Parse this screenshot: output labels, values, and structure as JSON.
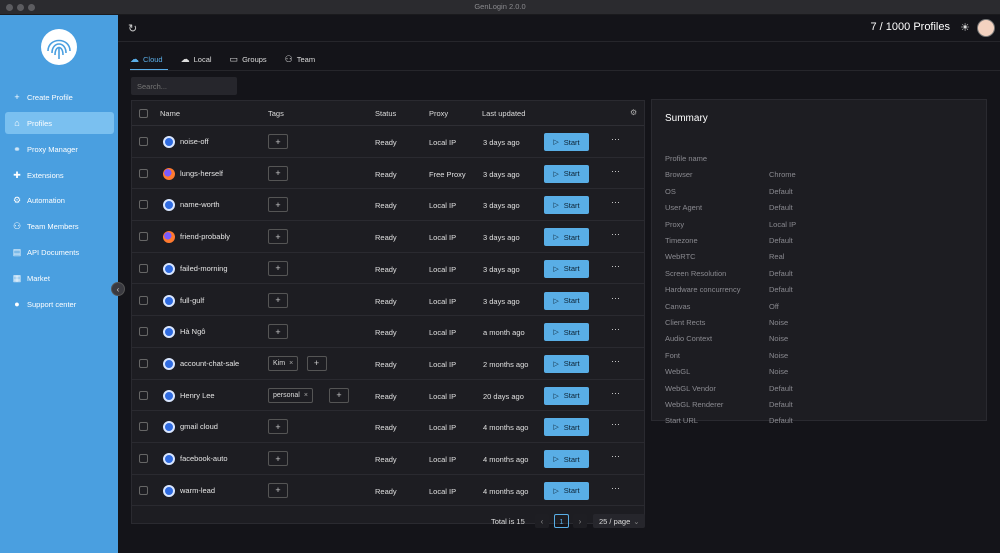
{
  "window": {
    "title": "GenLogin 2.0.0"
  },
  "sidebar": {
    "items": [
      {
        "label": "Create Profile",
        "icon": "plus-icon"
      },
      {
        "label": "Profiles",
        "icon": "home-icon",
        "active": true
      },
      {
        "label": "Proxy Manager",
        "icon": "link-icon"
      },
      {
        "label": "Extensions",
        "icon": "puzzle-icon"
      },
      {
        "label": "Automation",
        "icon": "gear-icon"
      },
      {
        "label": "Team Members",
        "icon": "users-icon"
      },
      {
        "label": "API Documents",
        "icon": "document-icon"
      },
      {
        "label": "Market",
        "icon": "store-icon"
      },
      {
        "label": "Support center",
        "icon": "chat-icon"
      }
    ]
  },
  "header": {
    "profiles_count": "7 / 1000 Profiles"
  },
  "tabs": [
    {
      "label": "Cloud",
      "icon": "cloud-icon",
      "active": true
    },
    {
      "label": "Local",
      "icon": "cloud-off-icon"
    },
    {
      "label": "Groups",
      "icon": "folder-icon"
    },
    {
      "label": "Team",
      "icon": "team-icon"
    }
  ],
  "search": {
    "placeholder": "Search..."
  },
  "table": {
    "columns": [
      "Name",
      "Tags",
      "Status",
      "Proxy",
      "Last updated"
    ],
    "start_label": "Start",
    "rows": [
      {
        "name": "noise-off",
        "browser": "chrome",
        "tags": [],
        "status": "Ready",
        "proxy": "Local IP",
        "updated": "3 days ago"
      },
      {
        "name": "lungs-herself",
        "browser": "firefox",
        "tags": [],
        "status": "Ready",
        "proxy": "Free Proxy",
        "updated": "3 days ago"
      },
      {
        "name": "name-worth",
        "browser": "chrome",
        "tags": [],
        "status": "Ready",
        "proxy": "Local IP",
        "updated": "3 days ago"
      },
      {
        "name": "friend-probably",
        "browser": "firefox",
        "tags": [],
        "status": "Ready",
        "proxy": "Local IP",
        "updated": "3 days ago"
      },
      {
        "name": "failed-morning",
        "browser": "chrome",
        "tags": [],
        "status": "Ready",
        "proxy": "Local IP",
        "updated": "3 days ago"
      },
      {
        "name": "full-gulf",
        "browser": "chrome",
        "tags": [],
        "status": "Ready",
        "proxy": "Local IP",
        "updated": "3 days ago"
      },
      {
        "name": "Hà Ngô",
        "browser": "chrome",
        "tags": [],
        "status": "Ready",
        "proxy": "Local IP",
        "updated": "a month ago"
      },
      {
        "name": "account-chat-sale",
        "browser": "chrome",
        "tags": [
          "Kim"
        ],
        "status": "Ready",
        "proxy": "Local IP",
        "updated": "2 months ago"
      },
      {
        "name": "Henry Lee",
        "browser": "chrome",
        "tags": [
          "personal"
        ],
        "status": "Ready",
        "proxy": "Local IP",
        "updated": "20 days ago"
      },
      {
        "name": "gmail cloud",
        "browser": "chrome",
        "tags": [],
        "status": "Ready",
        "proxy": "Local IP",
        "updated": "4 months ago"
      },
      {
        "name": "facebook-auto",
        "browser": "chrome",
        "tags": [],
        "status": "Ready",
        "proxy": "Local IP",
        "updated": "4 months ago"
      },
      {
        "name": "warm-lead",
        "browser": "chrome",
        "tags": [],
        "status": "Ready",
        "proxy": "Local IP",
        "updated": "4 months ago"
      }
    ]
  },
  "pagination": {
    "total": "Total is 15",
    "page": "1",
    "page_size": "25 / page"
  },
  "summary": {
    "title": "Summary",
    "rows": [
      {
        "key": "Profile name",
        "value": ""
      },
      {
        "key": "Browser",
        "value": "Chrome"
      },
      {
        "key": "OS",
        "value": "Default"
      },
      {
        "key": "User Agent",
        "value": "Default"
      },
      {
        "key": "Proxy",
        "value": "Local IP"
      },
      {
        "key": "Timezone",
        "value": "Default"
      },
      {
        "key": "WebRTC",
        "value": "Real"
      },
      {
        "key": "Screen Resolution",
        "value": "Default"
      },
      {
        "key": "Hardware concurrency",
        "value": "Default"
      },
      {
        "key": "Canvas",
        "value": "Off"
      },
      {
        "key": "Client Rects",
        "value": "Noise"
      },
      {
        "key": "Audio Context",
        "value": "Noise"
      },
      {
        "key": "Font",
        "value": "Noise"
      },
      {
        "key": "WebGL",
        "value": "Noise"
      },
      {
        "key": "WebGL Vendor",
        "value": "Default"
      },
      {
        "key": "WebGL Renderer",
        "value": "Default"
      },
      {
        "key": "Start URL",
        "value": "Default"
      }
    ]
  },
  "colors": {
    "accent": "#59aee6",
    "sidebar": "#4a9fe0",
    "background": "#141419"
  }
}
